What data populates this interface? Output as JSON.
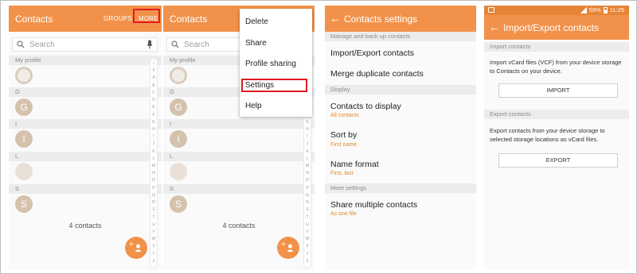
{
  "colors": {
    "accent": "#f2924a",
    "highlight": "#e01b22",
    "secondary_text": "#e08b2a"
  },
  "screen1": {
    "title": "Contacts",
    "groups_label": "GROUPS",
    "more_label": "MORE",
    "search_placeholder": "Search",
    "sections": [
      "My profile",
      "G",
      "I",
      "L",
      "S"
    ],
    "avatars": [
      "G",
      "I",
      "S"
    ],
    "count": "4 contacts"
  },
  "screen2": {
    "title": "Contacts",
    "search_placeholder": "Search",
    "sections": [
      "My profile",
      "G",
      "I",
      "L",
      "S"
    ],
    "avatars": [
      "G",
      "I",
      "S"
    ],
    "count": "4 contacts",
    "menu": [
      "Delete",
      "Share",
      "Profile sharing",
      "Settings",
      "Help"
    ]
  },
  "index_letters": [
    "☆",
    "#",
    "A",
    "B",
    "C",
    "D",
    "E",
    "F",
    "G",
    "H",
    "I",
    "J",
    "K",
    "L",
    "M",
    "N",
    "O",
    "P",
    "Q",
    "R",
    "S",
    "T",
    "U",
    "V",
    "W",
    "X",
    "Y",
    "Z"
  ],
  "screen3": {
    "title": "Contacts settings",
    "sections": {
      "manage": "Manage and back up contacts",
      "display": "Display",
      "more": "More settings"
    },
    "items": {
      "import_export": "Import/Export contacts",
      "merge": "Merge duplicate contacts",
      "to_display": "Contacts to display",
      "to_display_sub": "All contacts",
      "sort_by": "Sort by",
      "sort_by_sub": "First name",
      "name_format": "Name format",
      "name_format_sub": "First, last",
      "share_multiple": "Share multiple contacts",
      "share_multiple_sub": "As one file"
    }
  },
  "screen4": {
    "status": {
      "battery": "59%",
      "time": "11:25"
    },
    "title": "Import/Export contacts",
    "import_header": "Import contacts",
    "import_text": "Import vCard files (VCF) from your device storage to Contacts on your device.",
    "import_button": "IMPORT",
    "export_header": "Export contacts",
    "export_text": "Export contacts from your device storage to selected storage locations as vCard files.",
    "export_button": "EXPORT"
  }
}
